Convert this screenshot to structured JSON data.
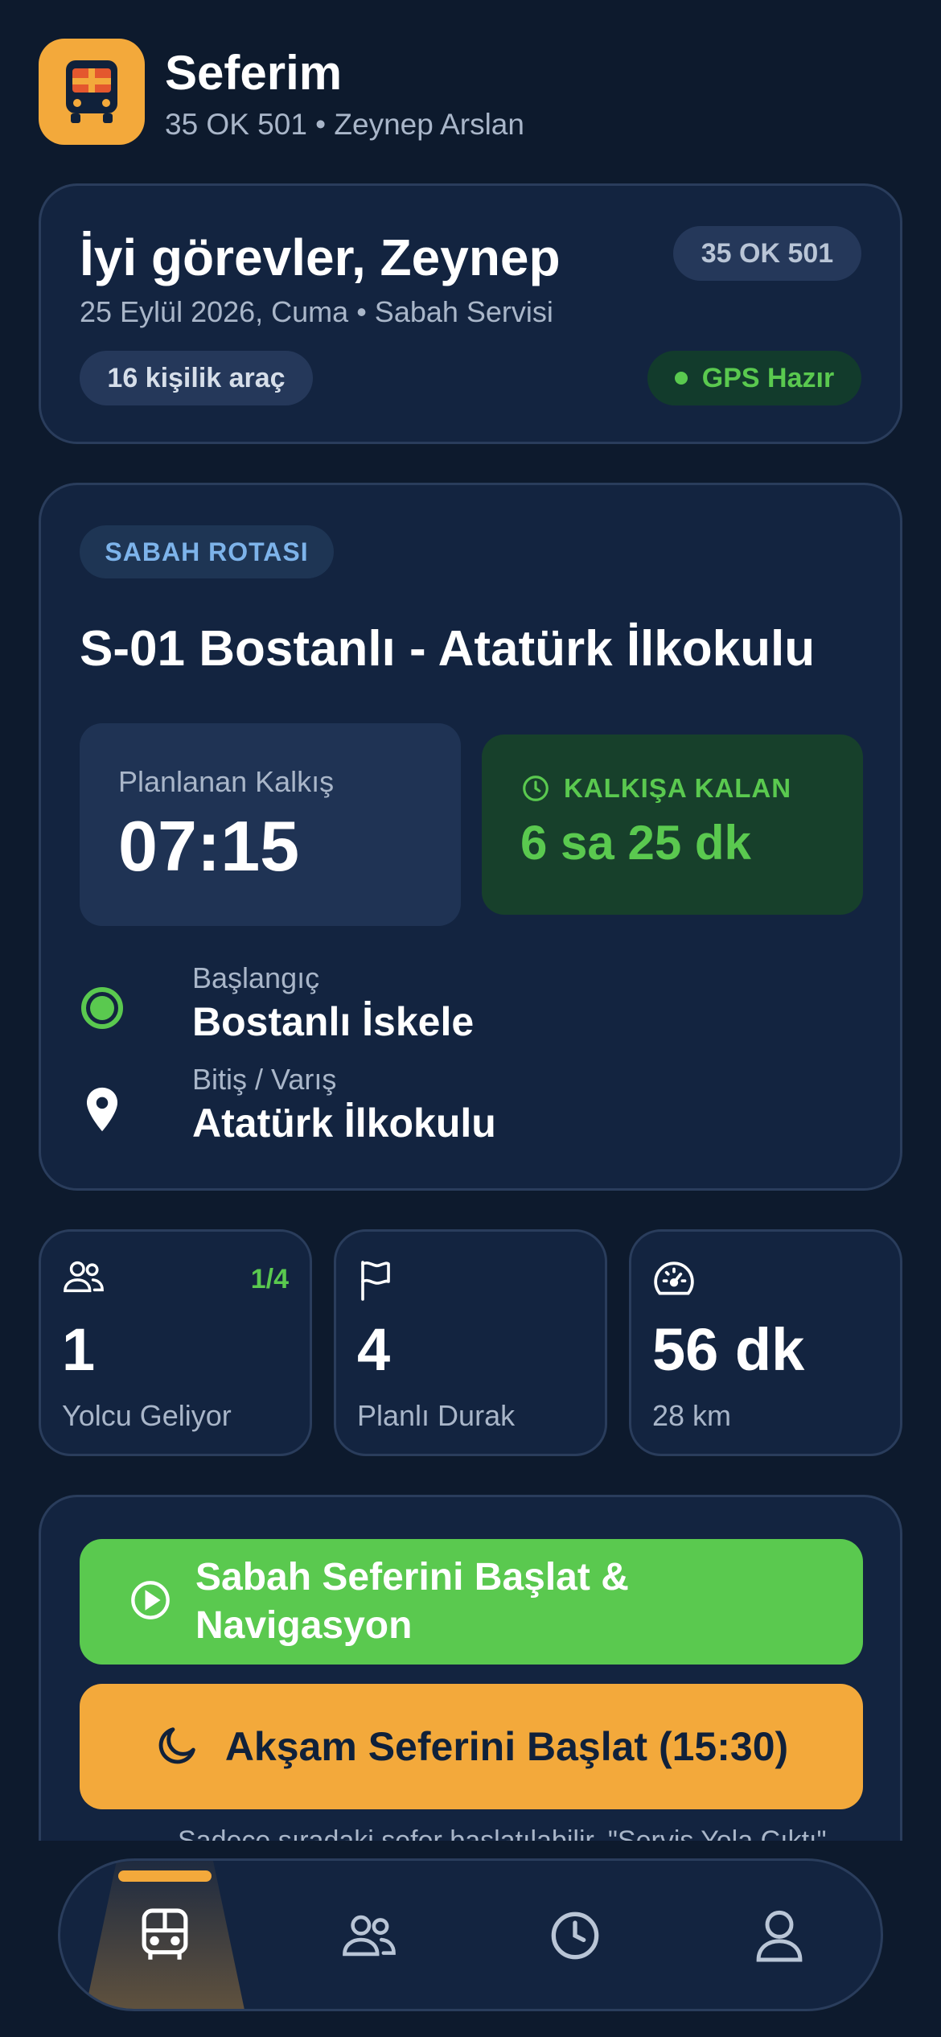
{
  "header": {
    "title": "Seferim",
    "subtitle": "35 OK 501 • Zeynep Arslan",
    "logo_icon": "bus-icon"
  },
  "greeting": {
    "title": "İyi görevler, Zeynep",
    "date_line": "25 Eylül 2026, Cuma • Sabah Servisi",
    "plate": "35 OK 501",
    "capacity": "16 kişilik araç",
    "gps_status": "GPS Hazır"
  },
  "route": {
    "tag": "SABAH ROTASI",
    "name": "S-01 Bostanlı - Atatürk İlkokulu",
    "departure_label": "Planlanan Kalkış",
    "departure_time": "07:15",
    "remaining_label": "KALKIŞA KALAN",
    "remaining_value": "6 sa 25 dk",
    "start_label": "Başlangıç",
    "start_value": "Bostanlı İskele",
    "end_label": "Bitiş / Varış",
    "end_value": "Atatürk İlkokulu"
  },
  "stats": [
    {
      "icon": "users-icon",
      "badge": "1/4",
      "value": "1",
      "label": "Yolcu Geliyor"
    },
    {
      "icon": "flag-icon",
      "badge": "",
      "value": "4",
      "label": "Planlı Durak"
    },
    {
      "icon": "gauge-icon",
      "badge": "",
      "value": "56 dk",
      "label": "28 km"
    }
  ],
  "actions": {
    "morning_line1": "Sabah Seferini Başlat &",
    "morning_line2": "Navigasyon",
    "evening": "Akşam Seferini Başlat (15:30)",
    "hint": "Sadece sıradaki sefer başlatılabilir. \"Servis Yola Çıktı\""
  },
  "nav": {
    "items": [
      "bus-icon",
      "users-icon",
      "clock-icon",
      "user-icon"
    ],
    "active_index": 0
  },
  "colors": {
    "background": "#0d1a2d",
    "card": "#132440",
    "accent_orange": "#f3a93b",
    "accent_green": "#5ac94f"
  }
}
